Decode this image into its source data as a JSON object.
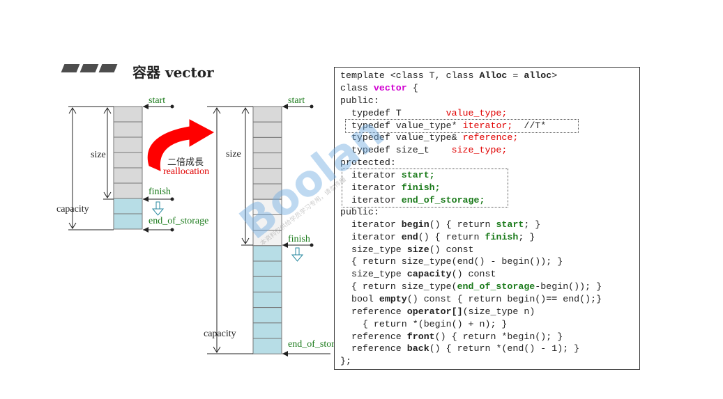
{
  "title": "容器 vector",
  "diagram": {
    "small": {
      "start": "start",
      "finish": "finish",
      "end_of_storage": "end_of_storage",
      "size": "size",
      "capacity": "capacity"
    },
    "growth": {
      "label_cn": "二倍成長",
      "label_en": "reallocation"
    },
    "large": {
      "start": "start",
      "finish": "finish",
      "end_of_storage": "end_of_storage",
      "size": "size",
      "capacity": "capacity"
    }
  },
  "code": {
    "l1a": "template <class T, class ",
    "l1b": "Alloc",
    "l1c": " = ",
    "l1d": "alloc",
    "l1e": ">",
    "l2a": "class ",
    "l2b": "vector",
    "l2c": " {",
    "l3": "public:",
    "l4a": "  typedef T        ",
    "l4b": "value_type;",
    "l5a": "  typedef value_type* ",
    "l5b": "iterator;",
    "l5c": "  //T*",
    "l6a": "  typedef value_type& ",
    "l6b": "reference;",
    "l7a": "  typedef size_t    ",
    "l7b": "size_type;",
    "l8": "protected:",
    "l9a": "  iterator ",
    "l9b": "start;",
    "l10a": "  iterator ",
    "l10b": "finish;",
    "l11a": "  iterator ",
    "l11b": "end_of_storage;",
    "l12": "public:",
    "l13a": "  iterator ",
    "l13b": "begin",
    "l13c": "() { return ",
    "l13d": "start",
    "l13e": "; }",
    "l14a": "  iterator ",
    "l14b": "end",
    "l14c": "() { return ",
    "l14d": "finish",
    "l14e": "; }",
    "l15a": "  size_type ",
    "l15b": "size",
    "l15c": "() const",
    "l16": "  { return size_type(end() - begin()); }",
    "l17a": "  size_type ",
    "l17b": "capacity",
    "l17c": "() const",
    "l18a": "  { return size_type(",
    "l18b": "end_of_storage",
    "l18c": "-begin()); }",
    "l19a": "  bool ",
    "l19b": "empty",
    "l19c": "() const { return begin()",
    "l19d": "==",
    "l19e": " end();}",
    "l20a": "  reference ",
    "l20b": "operator[]",
    "l20c": "(size_type n)",
    "l21": "    { return *(begin() + n); }",
    "l22a": "  reference ",
    "l22b": "front",
    "l22c": "() { return *begin(); }",
    "l23a": "  reference ",
    "l23b": "back",
    "l23c": "() { return *(end() - 1); }",
    "l24": "};"
  },
  "watermark": {
    "text": "Boolan",
    "sub": "本资料仅供给学员学习专用，请勿传播"
  },
  "colors": {
    "used_cell": "#d9d9d9",
    "spare_cell_small": "#b7dde6",
    "spare_cell_large": "#f2f2f2",
    "new_cell": "#b7dde6",
    "arrow": "#ff0000",
    "green_label": "#1a7a1a",
    "red_text": "#e00000",
    "keyword_vector": "#d000d0"
  }
}
